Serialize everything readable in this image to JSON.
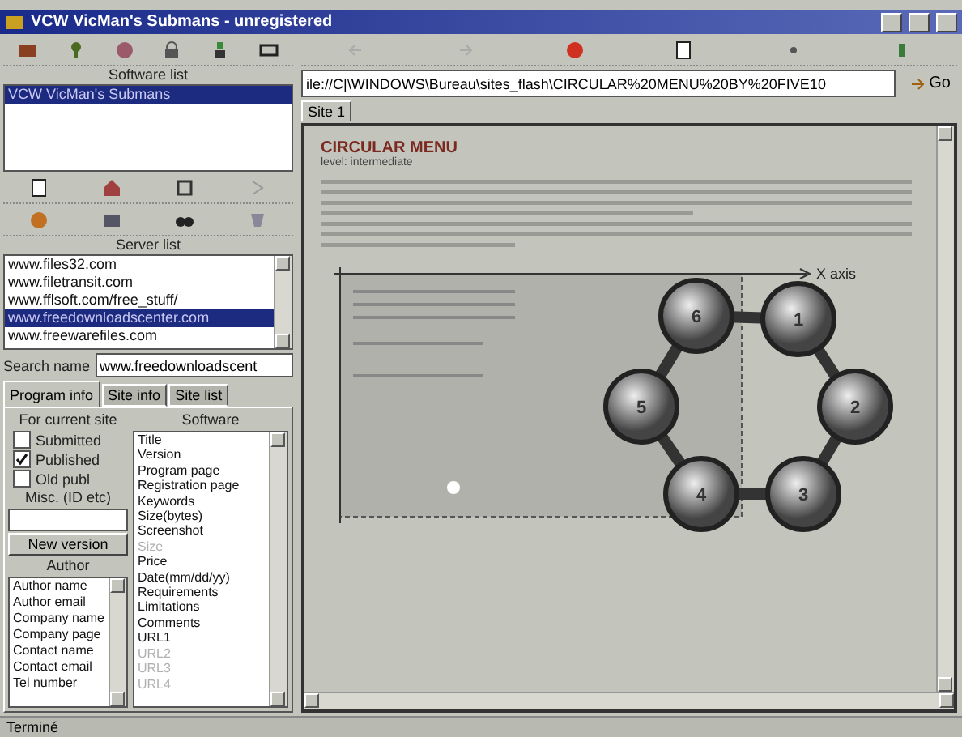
{
  "window": {
    "title": "VCW VicMan's Submans - unregistered"
  },
  "software_list": {
    "label": "Software list",
    "items": [
      {
        "text": "VCW VicMan's Submans",
        "selected": true
      }
    ]
  },
  "server_list": {
    "label": "Server list",
    "items": [
      {
        "text": "www.files32.com",
        "selected": false
      },
      {
        "text": "www.filetransit.com",
        "selected": false
      },
      {
        "text": "www.fflsoft.com/free_stuff/",
        "selected": false
      },
      {
        "text": "www.freedownloadscenter.com",
        "selected": true
      },
      {
        "text": "www.freewarefiles.com",
        "selected": false
      }
    ]
  },
  "search": {
    "label": "Search name",
    "value": "www.freedownloadscent"
  },
  "tabs": [
    {
      "label": "Program info",
      "selected": true
    },
    {
      "label": "Site info",
      "selected": false
    },
    {
      "label": "Site list",
      "selected": false
    }
  ],
  "current_site": {
    "label": "For current site",
    "checkboxes": [
      {
        "label": "Submitted",
        "checked": false
      },
      {
        "label": "Published",
        "checked": true
      },
      {
        "label": "Old publ",
        "checked": false
      }
    ],
    "misc_label": "Misc. (ID etc)",
    "button": "New version"
  },
  "author": {
    "label": "Author",
    "items": [
      "Author name",
      "Author email",
      "Company name",
      "Company page",
      "Contact name",
      "Contact email",
      "Tel number"
    ]
  },
  "software": {
    "label": "Software",
    "items": [
      {
        "text": "Title",
        "disabled": false
      },
      {
        "text": "Version",
        "disabled": false
      },
      {
        "text": "Program page",
        "disabled": false
      },
      {
        "text": "Registration page",
        "disabled": false
      },
      {
        "text": "Keywords",
        "disabled": false
      },
      {
        "text": "Size(bytes)",
        "disabled": false
      },
      {
        "text": "Screenshot",
        "disabled": false
      },
      {
        "text": "Size",
        "disabled": true
      },
      {
        "text": "Price",
        "disabled": false
      },
      {
        "text": "Date(mm/dd/yy)",
        "disabled": false
      },
      {
        "text": "Requirements",
        "disabled": false
      },
      {
        "text": "Limitations",
        "disabled": false
      },
      {
        "text": "Comments",
        "disabled": false
      },
      {
        "text": "URL1",
        "disabled": false
      },
      {
        "text": "URL2",
        "disabled": true
      },
      {
        "text": "URL3",
        "disabled": true
      },
      {
        "text": "URL4",
        "disabled": true
      }
    ]
  },
  "browser": {
    "address": "ile://C|\\WINDOWS\\Bureau\\sites_flash\\CIRCULAR%20MENU%20BY%20FIVE10",
    "go": "Go",
    "tabs": [
      {
        "label": "Site 1",
        "selected": true
      }
    ],
    "page": {
      "heading": "CIRCULAR MENU",
      "subheading": "level: intermediate",
      "x_axis_label": "X axis",
      "balls": [
        "6",
        "1",
        "2",
        "3",
        "4",
        "5"
      ]
    }
  },
  "status_bar": "Terminé"
}
